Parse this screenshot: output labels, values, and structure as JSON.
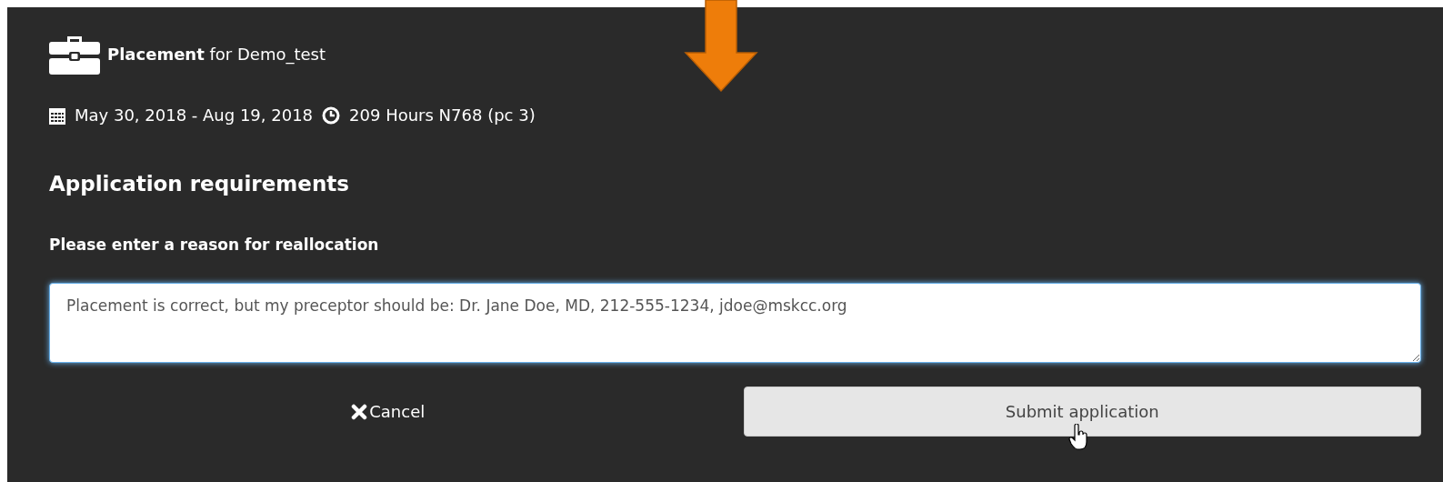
{
  "header": {
    "title": "**Placement** for Demo_test",
    "dates": "May 30, 2018 - Aug 19, 2018",
    "hours": "209 Hours N768 (pc 3)"
  },
  "section_title": "Application requirements",
  "reason": {
    "label": "Please enter a reason for reallocation",
    "value": "Placement is correct, but my preceptor should be: Dr. Jane Doe, MD, 212-555-1234, jdoe@mskcc.org"
  },
  "buttons": [
    {
      "kind": "cancel",
      "label": "Cancel"
    },
    {
      "kind": "submit",
      "label": "Submit application"
    }
  ]
}
